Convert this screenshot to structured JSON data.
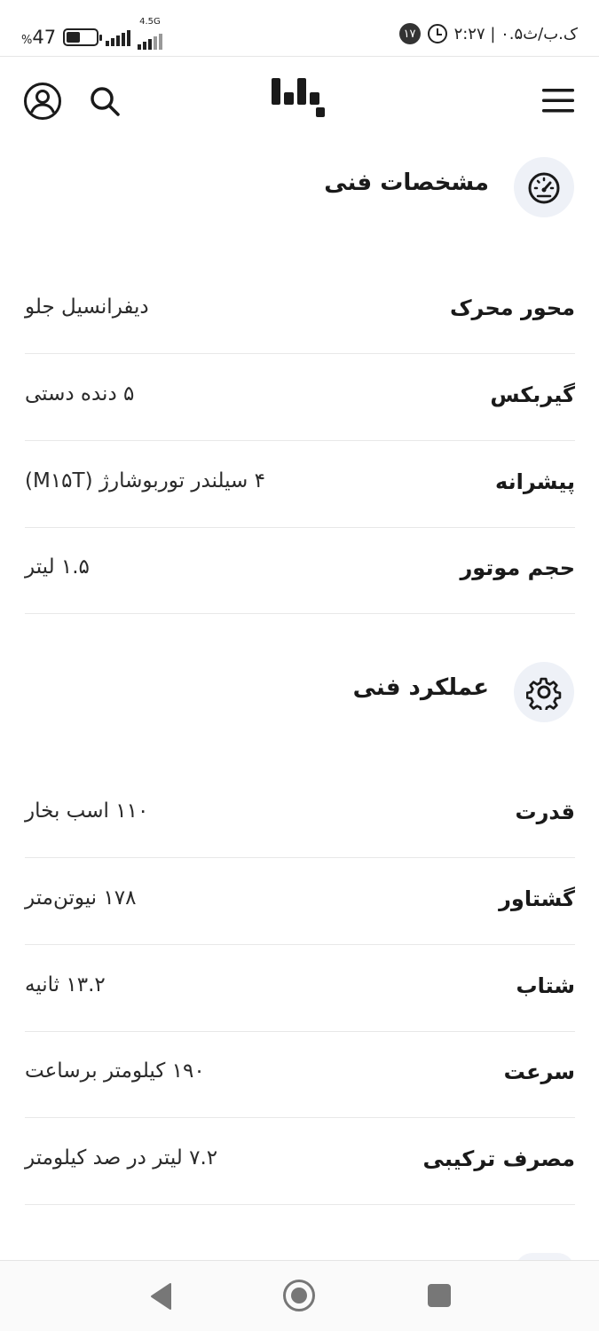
{
  "status_bar": {
    "battery_percent": "47",
    "battery_level": 0.47,
    "network_type": "4.5G",
    "time_text": "۲:۲۷ | ۰.۵ک.ب/ث",
    "notification_count": "۱۷",
    "icons": [
      "battery-icon",
      "signal-icon",
      "alarm-clock-icon",
      "notification-badge"
    ]
  },
  "header": {
    "icons": [
      "profile-icon",
      "search-icon",
      "logo-icon",
      "hamburger-menu-icon"
    ]
  },
  "sections": [
    {
      "title": "مشخصات فنی",
      "icon": "speedometer-icon",
      "rows": [
        {
          "label": "محور محرک",
          "value": "دیفرانسیل جلو"
        },
        {
          "label": "گیربکس",
          "value": "۵ دنده دستی"
        },
        {
          "label": "پیشرانه",
          "value": "۴ سیلندر توربوشارژ (M۱۵T)"
        },
        {
          "label": "حجم موتور",
          "value": "۱.۵ لیتر"
        }
      ]
    },
    {
      "title": "عملکرد فنی",
      "icon": "gear-icon",
      "rows": [
        {
          "label": "قدرت",
          "value": "۱۱۰ اسب بخار"
        },
        {
          "label": "گشتاور",
          "value": "۱۷۸ نیوتن‌متر"
        },
        {
          "label": "شتاب",
          "value": "۱۳.۲ ثانیه"
        },
        {
          "label": "سرعت",
          "value": "۱۹۰ کیلومتر برساعت"
        },
        {
          "label": "مصرف ترکیبی",
          "value": "۷.۲ لیتر در صد کیلومتر"
        }
      ]
    }
  ],
  "nav": {
    "icons": [
      "back-triangle-icon",
      "home-circle-icon",
      "recent-apps-square-icon"
    ]
  }
}
